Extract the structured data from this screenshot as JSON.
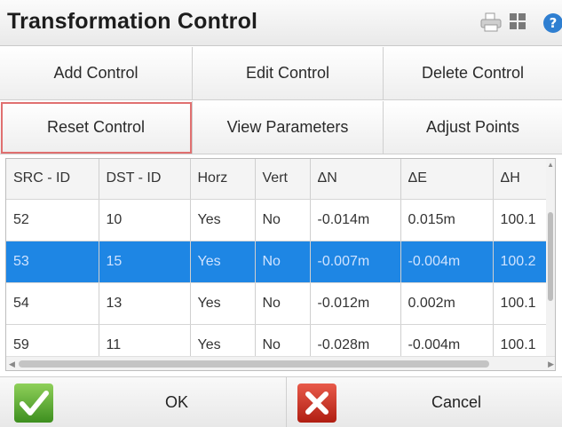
{
  "window": {
    "title": "Transformation Control"
  },
  "toolbar": {
    "icons": [
      "printer-icon",
      "grid-icon",
      "help-icon"
    ]
  },
  "control_buttons": {
    "add": "Add Control",
    "edit": "Edit Control",
    "delete": "Delete Control",
    "reset": "Reset Control",
    "view_parameters": "View Parameters",
    "adjust_points": "Adjust Points",
    "focused": "Reset Control"
  },
  "table": {
    "headers": [
      "SRC - ID",
      "DST - ID",
      "Horz",
      "Vert",
      "ΔN",
      "ΔE",
      "ΔH"
    ],
    "rows": [
      [
        "52",
        "10",
        "Yes",
        "No",
        "-0.014m",
        "0.015m",
        "100.1"
      ],
      [
        "53",
        "15",
        "Yes",
        "No",
        "-0.007m",
        "-0.004m",
        "100.2"
      ],
      [
        "54",
        "13",
        "Yes",
        "No",
        "-0.012m",
        "0.002m",
        "100.1"
      ],
      [
        "59",
        "11",
        "Yes",
        "No",
        "-0.028m",
        "-0.004m",
        "100.1"
      ]
    ],
    "selected_row": 1
  },
  "footer": {
    "ok": "OK",
    "cancel": "Cancel"
  },
  "colors": {
    "selection": "#1e86e4",
    "focus_outline": "#e07070",
    "ok_green": "#3d8f1f",
    "cancel_red": "#b01e12"
  }
}
